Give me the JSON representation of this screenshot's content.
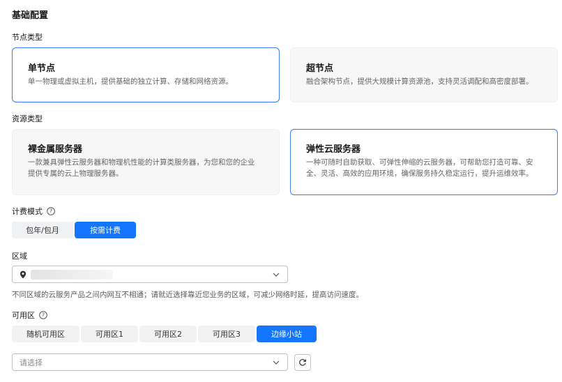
{
  "section_title": "基础配置",
  "node_type": {
    "label": "节点类型",
    "options": [
      {
        "title": "单节点",
        "desc": "单一物理或虚拟主机，提供基础的独立计算、存储和网络资源。",
        "selected": true
      },
      {
        "title": "超节点",
        "desc": "融合架构节点，提供大规模计算资源池，支持灵活调配和高密度部署。",
        "selected": false
      }
    ]
  },
  "resource_type": {
    "label": "资源类型",
    "options": [
      {
        "title": "裸金属服务器",
        "desc_line1": "一款兼具弹性云服务器和物理机性能的计算类服务器，为您和您的企业",
        "desc_line2": "提供专属的云上物理服务器。",
        "selected": false
      },
      {
        "title": "弹性云服务器",
        "desc_line1": "一种可随时自助获取、可弹性伸缩的云服务器，可帮助您打造可靠、安",
        "desc_line2": "全、灵活、高效的应用环境，确保服务持久稳定运行，提升运维效率。",
        "selected": true
      }
    ]
  },
  "billing": {
    "label": "计费模式",
    "options": [
      "包年/包月",
      "按需计费"
    ],
    "selected_index": 1
  },
  "region": {
    "label": "区域",
    "hint": "不同区域的云服务产品之间内网互不相通；请就近选择靠近您业务的区域，可减少网络时延，提高访问速度。"
  },
  "az": {
    "label": "可用区",
    "options": [
      "随机可用区",
      "可用区1",
      "可用区2",
      "可用区3",
      "边缘小站"
    ],
    "selected_index": 4,
    "select_placeholder": "请选择"
  },
  "colors": {
    "accent": "#1476ff",
    "selected_border": "#3b7cf2"
  },
  "icons": [
    "help-icon",
    "location-pin-icon",
    "chevron-down-icon",
    "refresh-icon"
  ]
}
